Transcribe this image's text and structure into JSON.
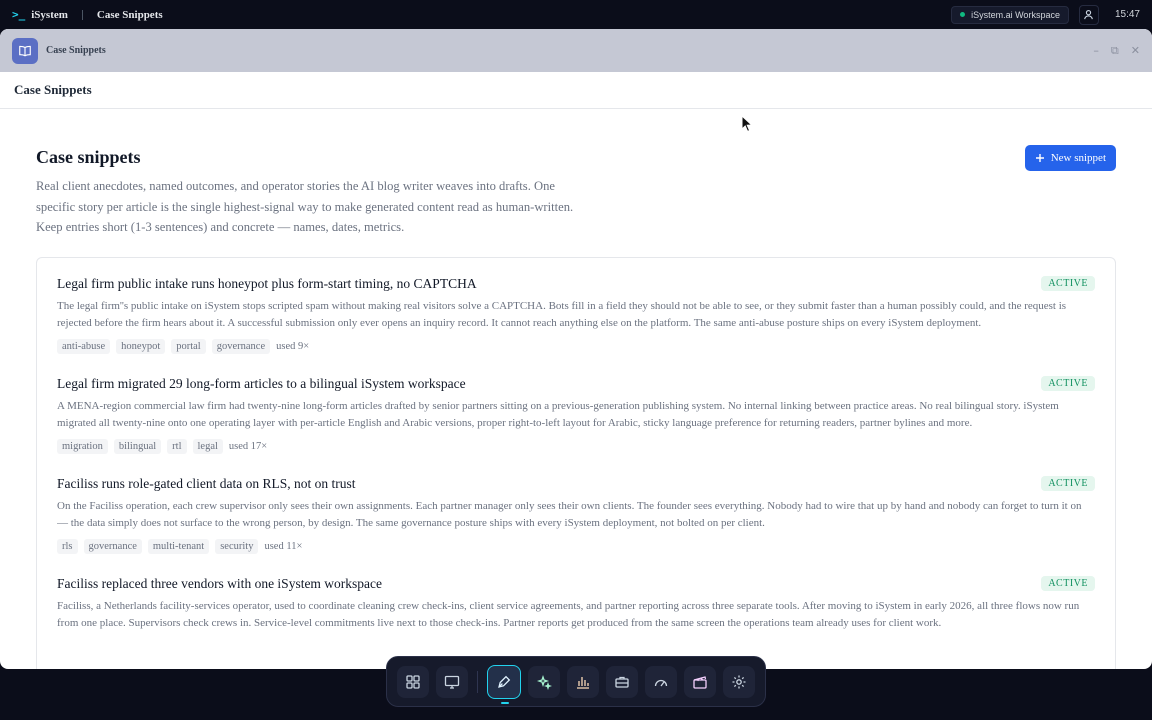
{
  "topbar": {
    "brand": "iSystem",
    "app_name": "Case Snippets",
    "workspace": "iSystem.ai Workspace",
    "clock": "15:47"
  },
  "window": {
    "title": "Case Snippets",
    "page_header": "Case Snippets"
  },
  "main": {
    "heading": "Case snippets",
    "description": "Real client anecdotes, named outcomes, and operator stories the AI blog writer weaves into drafts. One specific story per article is the single highest-signal way to make generated content read as human-written. Keep entries short (1-3 sentences) and concrete — names, dates, metrics.",
    "new_button_label": "New snippet"
  },
  "snippets": [
    {
      "title": "Legal firm public intake runs honeypot plus form-start timing, no CAPTCHA",
      "status": "ACTIVE",
      "body": "The legal firm''s public intake on iSystem stops scripted spam without making real visitors solve a CAPTCHA. Bots fill in a field they should not be able to see, or they submit faster than a human possibly could, and the request is rejected before the firm hears about it. A successful submission only ever opens an inquiry record. It cannot reach anything else on the platform. The same anti-abuse posture ships on every iSystem deployment.",
      "tags": [
        "anti-abuse",
        "honeypot",
        "portal",
        "governance"
      ],
      "used": "used 9×"
    },
    {
      "title": "Legal firm migrated 29 long-form articles to a bilingual iSystem workspace",
      "status": "ACTIVE",
      "body": "A MENA-region commercial law firm had twenty-nine long-form articles drafted by senior partners sitting on a previous-generation publishing system. No internal linking between practice areas. No real bilingual story. iSystem migrated all twenty-nine onto one operating layer with per-article English and Arabic versions, proper right-to-left layout for Arabic, sticky language preference for returning readers, partner bylines and more.",
      "tags": [
        "migration",
        "bilingual",
        "rtl",
        "legal"
      ],
      "used": "used 17×"
    },
    {
      "title": "Faciliss runs role-gated client data on RLS, not on trust",
      "status": "ACTIVE",
      "body": "On the Faciliss operation, each crew supervisor only sees their own assignments. Each partner manager only sees their own clients. The founder sees everything. Nobody had to wire that up by hand and nobody can forget to turn it on — the data simply does not surface to the wrong person, by design. The same governance posture ships with every iSystem deployment, not bolted on per client.",
      "tags": [
        "rls",
        "governance",
        "multi-tenant",
        "security"
      ],
      "used": "used 11×"
    },
    {
      "title": "Faciliss replaced three vendors with one iSystem workspace",
      "status": "ACTIVE",
      "body": "Faciliss, a Netherlands facility-services operator, used to coordinate cleaning crew check-ins, client service agreements, and partner reporting across three separate tools. After moving to iSystem in early 2026, all three flows now run from one place. Supervisors check crews in. Service-level commitments live next to those check-ins. Partner reports get produced from the same screen the operations team already uses for client work.",
      "tags": [],
      "used": ""
    }
  ],
  "dock": {
    "items": [
      "apps-grid-icon",
      "monitor-icon",
      "pen-tool-icon",
      "sparkles-icon",
      "bar-chart-icon",
      "briefcase-icon",
      "gauge-icon",
      "clapperboard-icon",
      "settings-icon"
    ],
    "active": "pen-tool-icon"
  }
}
